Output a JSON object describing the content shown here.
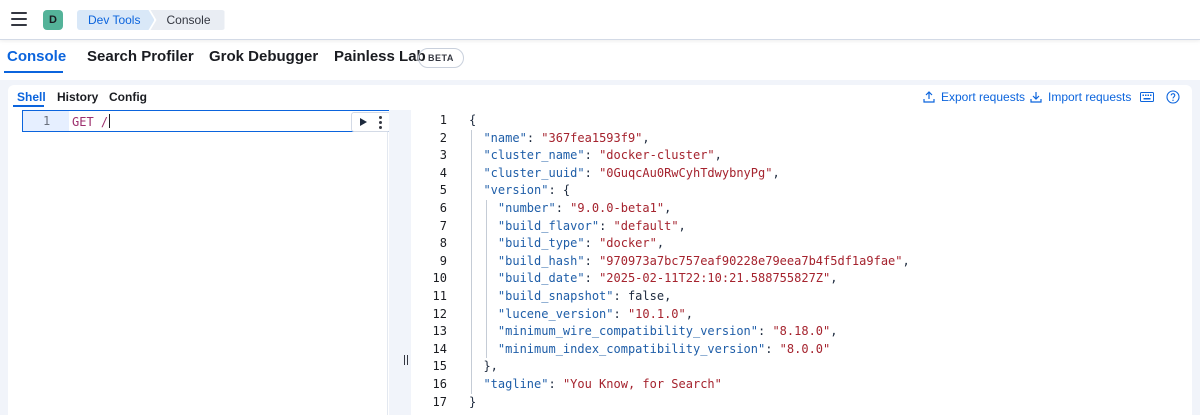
{
  "header": {
    "avatar_letter": "D",
    "breadcrumbs": [
      "Dev Tools",
      "Console"
    ]
  },
  "main_tabs": [
    {
      "label": "Console",
      "active": true
    },
    {
      "label": "Search Profiler"
    },
    {
      "label": "Grok Debugger"
    },
    {
      "label": "Painless Lab",
      "badge": "BETA"
    }
  ],
  "sub_tabs": [
    {
      "label": "Shell",
      "active": true
    },
    {
      "label": "History"
    },
    {
      "label": "Config"
    }
  ],
  "toolbar": {
    "export_label": "Export requests",
    "import_label": "Import requests"
  },
  "request": {
    "line_number": "1",
    "text": "GET /"
  },
  "response_lines": [
    {
      "n": "1",
      "html": "<span class=\"p\">{</span>"
    },
    {
      "n": "2",
      "html": "  <span class=\"k\">\"name\"</span>: <span class=\"s\">\"367fea1593f9\"</span>,"
    },
    {
      "n": "3",
      "html": "  <span class=\"k\">\"cluster_name\"</span>: <span class=\"s\">\"docker-cluster\"</span>,"
    },
    {
      "n": "4",
      "html": "  <span class=\"k\">\"cluster_uuid\"</span>: <span class=\"s\">\"0GuqcAu0RwCyhTdwybnyPg\"</span>,"
    },
    {
      "n": "5",
      "html": "  <span class=\"k\">\"version\"</span>: {"
    },
    {
      "n": "6",
      "html": "    <span class=\"k\">\"number\"</span>: <span class=\"s\">\"9.0.0-beta1\"</span>,"
    },
    {
      "n": "7",
      "html": "    <span class=\"k\">\"build_flavor\"</span>: <span class=\"s\">\"default\"</span>,"
    },
    {
      "n": "8",
      "html": "    <span class=\"k\">\"build_type\"</span>: <span class=\"s\">\"docker\"</span>,"
    },
    {
      "n": "9",
      "html": "    <span class=\"k\">\"build_hash\"</span>: <span class=\"s\">\"970973a7bc757eaf90228e79eea7b4f5df1a9fae\"</span>,"
    },
    {
      "n": "10",
      "html": "    <span class=\"k\">\"build_date\"</span>: <span class=\"s\">\"2025-02-11T22:10:21.588755827Z\"</span>,"
    },
    {
      "n": "11",
      "html": "    <span class=\"k\">\"build_snapshot\"</span>: false,"
    },
    {
      "n": "12",
      "html": "    <span class=\"k\">\"lucene_version\"</span>: <span class=\"s\">\"10.1.0\"</span>,"
    },
    {
      "n": "13",
      "html": "    <span class=\"k\">\"minimum_wire_compatibility_version\"</span>: <span class=\"s\">\"8.18.0\"</span>,"
    },
    {
      "n": "14",
      "html": "    <span class=\"k\">\"minimum_index_compatibility_version\"</span>: <span class=\"s\">\"8.0.0\"</span>"
    },
    {
      "n": "15",
      "html": "  },"
    },
    {
      "n": "16",
      "html": "  <span class=\"k\">\"tagline\"</span>: <span class=\"s\">\"You Know, for Search\"</span>"
    },
    {
      "n": "17",
      "html": "}"
    }
  ]
}
